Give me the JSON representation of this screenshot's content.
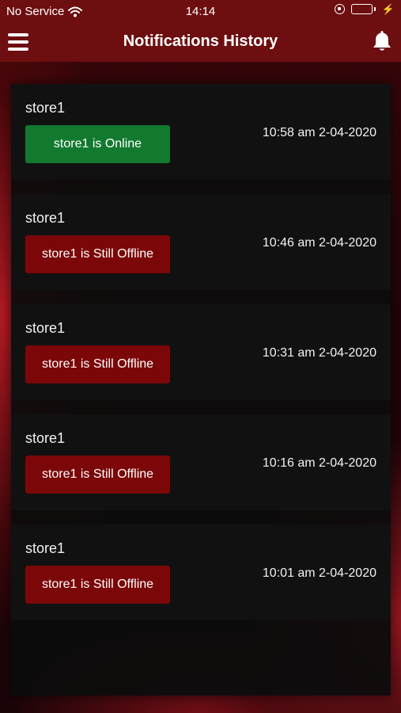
{
  "status_bar": {
    "carrier": "No Service",
    "time": "14:14",
    "battery_color": "#34c759",
    "icons": [
      "wifi-icon",
      "orientation-lock-icon",
      "battery-icon",
      "charging-bolt-icon"
    ]
  },
  "header": {
    "title": "Notifications History",
    "background": "#6d0e10",
    "icons": [
      "menu-icon",
      "bell-icon"
    ]
  },
  "notifications": [
    {
      "store": "store1",
      "status": "store1 is Online",
      "state": "online",
      "time": "10:58 am 2-04-2020"
    },
    {
      "store": "store1",
      "status": "store1 is Still Offline",
      "state": "offline",
      "time": "10:46 am 2-04-2020"
    },
    {
      "store": "store1",
      "status": "store1 is Still Offline",
      "state": "offline",
      "time": "10:31 am 2-04-2020"
    },
    {
      "store": "store1",
      "status": "store1 is Still Offline",
      "state": "offline",
      "time": "10:16 am 2-04-2020"
    },
    {
      "store": "store1",
      "status": "store1 is Still Offline",
      "state": "offline",
      "time": "10:01 am 2-04-2020"
    }
  ],
  "colors": {
    "online": "#127a2f",
    "offline": "#7c0708"
  }
}
